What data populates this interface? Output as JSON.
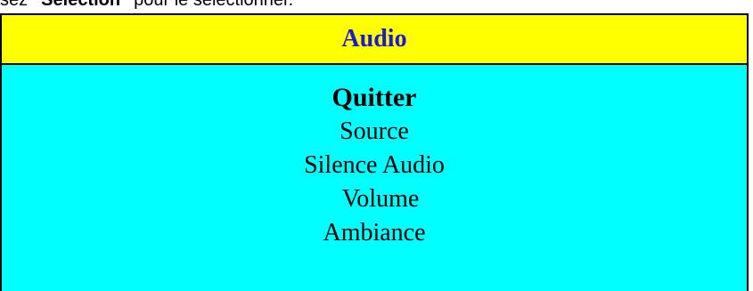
{
  "instruction": {
    "prefix": "sez ",
    "keyword": "\"Sélection\"",
    "suffix": " pour le sélectionner."
  },
  "menu": {
    "title": "Audio",
    "items": [
      {
        "label": "Quitter",
        "selected": true
      },
      {
        "label": "Source",
        "selected": false
      },
      {
        "label": "Silence Audio",
        "selected": false
      },
      {
        "label": "Volume",
        "selected": false
      },
      {
        "label": "Ambiance",
        "selected": false
      }
    ]
  },
  "colors": {
    "header_bg": "#ffff00",
    "header_text": "#1a1ad6",
    "body_bg": "#00ffff"
  }
}
